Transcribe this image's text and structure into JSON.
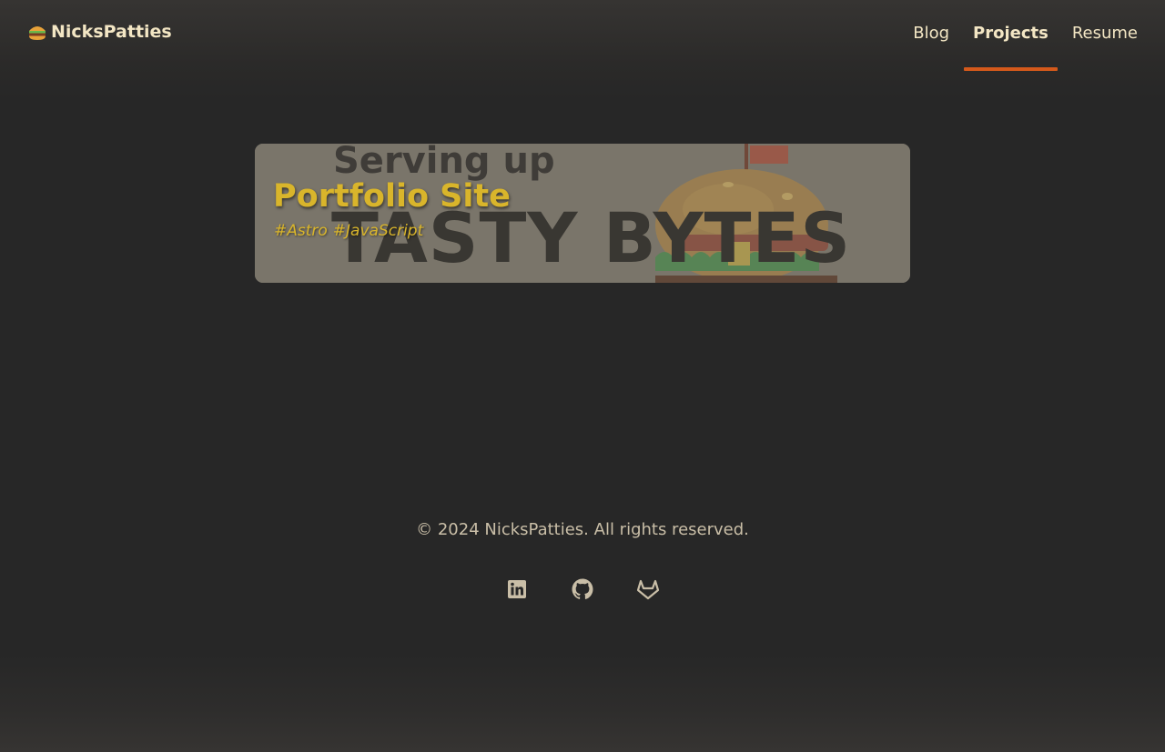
{
  "header": {
    "brand_emoji_icon": "burger-icon",
    "brand_name": "NicksPatties",
    "nav": [
      {
        "label": "Blog",
        "active": false
      },
      {
        "label": "Projects",
        "active": true
      },
      {
        "label": "Resume",
        "active": false
      }
    ],
    "accent_color": "#d4591b"
  },
  "projects": [
    {
      "title": "Portfolio Site",
      "tags": [
        "#Astro",
        "#JavaScript"
      ],
      "image_text_line1": "Serving up",
      "image_text_line2": "TASTY BYTES",
      "title_color": "#d9b52b"
    }
  ],
  "footer": {
    "copyright": "© 2024 NicksPatties. All rights reserved.",
    "social_icons": [
      "linkedin-icon",
      "github-icon",
      "gitlab-icon"
    ]
  }
}
